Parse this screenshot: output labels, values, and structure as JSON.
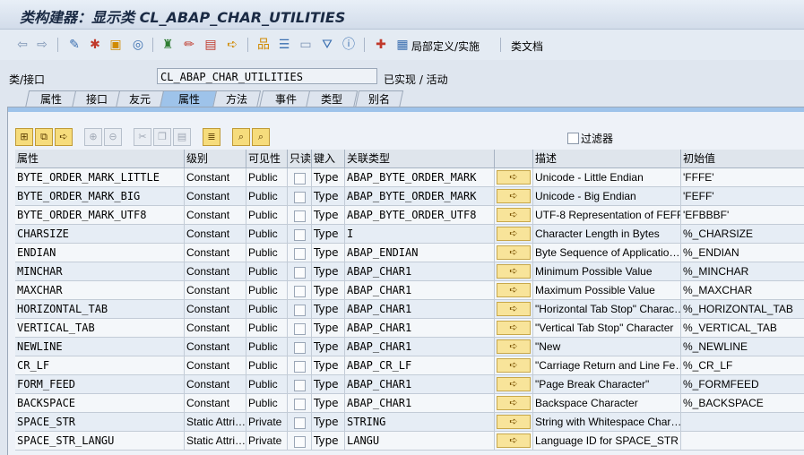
{
  "window": {
    "title": "类构建器：显示类 CL_ABAP_CHAR_UTILITIES"
  },
  "toolbar": {
    "icons": [
      "back-arrow-icon",
      "forward-arrow-icon",
      "pencil-glasses-icon",
      "objects-icon",
      "object-list-icon",
      "where-used-icon",
      "hierarchy-icon",
      "edit-icon",
      "display-object-icon",
      "execute-icon",
      "tree-icon",
      "align-icon",
      "frame-icon",
      "filter-icon",
      "info-icon",
      "local-def-icon"
    ],
    "local_def_label": "局部定义/实施",
    "class_doc_label": "类文档"
  },
  "class_row": {
    "label": "类/接口",
    "class_name": "CL_ABAP_CHAR_UTILITIES",
    "status": "已实现 / 活动"
  },
  "tabs": [
    {
      "label": "属性",
      "active": false
    },
    {
      "label": "接口",
      "active": false
    },
    {
      "label": "友元",
      "active": false
    },
    {
      "label": "属性",
      "active": true
    },
    {
      "label": "方法",
      "active": false
    },
    {
      "label": "事件",
      "active": false
    },
    {
      "label": "类型",
      "active": false
    },
    {
      "label": "别名",
      "active": false
    }
  ],
  "filter_label": "过滤器",
  "columns": [
    "属性",
    "级别",
    "可见性",
    "只读",
    "键入",
    "关联类型",
    "",
    "描述",
    "初始值"
  ],
  "rows": [
    [
      "BYTE_ORDER_MARK_LITTLE",
      "Constant",
      "Public",
      "Type",
      "ABAP_BYTE_ORDER_MARK",
      "Unicode - Little Endian",
      "'FFFE'"
    ],
    [
      "BYTE_ORDER_MARK_BIG",
      "Constant",
      "Public",
      "Type",
      "ABAP_BYTE_ORDER_MARK",
      "Unicode - Big Endian",
      "'FEFF'"
    ],
    [
      "BYTE_ORDER_MARK_UTF8",
      "Constant",
      "Public",
      "Type",
      "ABAP_BYTE_ORDER_UTF8",
      "UTF-8 Representation of FEFF",
      "'EFBBBF'"
    ],
    [
      "CHARSIZE",
      "Constant",
      "Public",
      "Type",
      "I",
      "Character Length in Bytes",
      "%_CHARSIZE"
    ],
    [
      "ENDIAN",
      "Constant",
      "Public",
      "Type",
      "ABAP_ENDIAN",
      "Byte Sequence of Applicatio…",
      "%_ENDIAN"
    ],
    [
      "MINCHAR",
      "Constant",
      "Public",
      "Type",
      "ABAP_CHAR1",
      "Minimum Possible Value",
      "%_MINCHAR"
    ],
    [
      "MAXCHAR",
      "Constant",
      "Public",
      "Type",
      "ABAP_CHAR1",
      "Maximum Possible Value",
      "%_MAXCHAR"
    ],
    [
      "HORIZONTAL_TAB",
      "Constant",
      "Public",
      "Type",
      "ABAP_CHAR1",
      "\"Horizontal Tab Stop\" Charac…",
      "%_HORIZONTAL_TAB"
    ],
    [
      "VERTICAL_TAB",
      "Constant",
      "Public",
      "Type",
      "ABAP_CHAR1",
      "\"Vertical Tab Stop\" Character",
      "%_VERTICAL_TAB"
    ],
    [
      "NEWLINE",
      "Constant",
      "Public",
      "Type",
      "ABAP_CHAR1",
      "\"New",
      "%_NEWLINE"
    ],
    [
      "CR_LF",
      "Constant",
      "Public",
      "Type",
      "ABAP_CR_LF",
      "\"Carriage Return and Line Fe…",
      "%_CR_LF"
    ],
    [
      "FORM_FEED",
      "Constant",
      "Public",
      "Type",
      "ABAP_CHAR1",
      "\"Page Break Character\"",
      "%_FORMFEED"
    ],
    [
      "BACKSPACE",
      "Constant",
      "Public",
      "Type",
      "ABAP_CHAR1",
      "Backspace Character",
      "%_BACKSPACE"
    ],
    [
      "SPACE_STR",
      "Static Attri…",
      "Private",
      "Type",
      "STRING",
      "String with Whitespace Char…",
      ""
    ],
    [
      "SPACE_STR_LANGU",
      "Static Attri…",
      "Private",
      "Type",
      "LANGU",
      "Language ID for SPACE_STR",
      ""
    ]
  ]
}
